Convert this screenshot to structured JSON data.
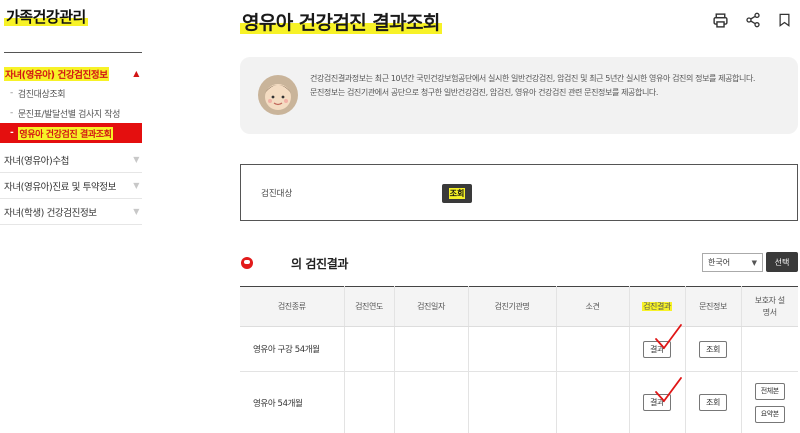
{
  "sidebar": {
    "title": "가족건강관리",
    "menu": [
      {
        "label": "자녀(영유아) 건강검진정보",
        "open": true,
        "children": [
          {
            "label": "검진대상조회",
            "active": false
          },
          {
            "label": "문진표/발달선별 검사지 작성",
            "active": false
          },
          {
            "label": "영유아 건강검진 결과조회",
            "active": true
          }
        ]
      },
      {
        "label": "자녀(영유아)수첩",
        "open": false
      },
      {
        "label": "자녀(영유아)진료 및 투약정보",
        "open": false
      },
      {
        "label": "자녀(학생) 건강검진정보",
        "open": false
      }
    ]
  },
  "header": {
    "title": "영유아 건강검진 결과조회",
    "tools": [
      "printer-icon",
      "share-icon",
      "bookmark-icon"
    ]
  },
  "info": {
    "line1": "건강검진결과정보는 최근 10년간 국민건강보험공단에서 실시한 일반건강검진, 암검진 및 최근 5년간 실시한 영유아 검진의 정보를 제공합니다.",
    "line2": "문진정보는 검진기관에서 공단으로 청구한 일반건강검진, 암검진, 영유아 건강검진 관련 문진정보를 제공합니다."
  },
  "filter": {
    "label": "검진대상",
    "query_button": "조회"
  },
  "results": {
    "title": "의 검진결과",
    "language": "한국어",
    "select_button": "선택",
    "columns": [
      "검진종류",
      "검진연도",
      "검진일자",
      "검진기관명",
      "소견",
      "검진결과",
      "문진정보",
      "보호자 설명서"
    ],
    "rows": [
      {
        "type": "영유아 구강 54개월",
        "year": "",
        "date": "",
        "institution": "",
        "opinion": "",
        "result_button": "결과",
        "interview_button": "조회",
        "guardian_buttons": []
      },
      {
        "type": "영유아 54개월",
        "year": "",
        "date": "",
        "institution": "",
        "opinion": "",
        "result_button": "결과",
        "interview_button": "조회",
        "guardian_buttons": [
          "전체본",
          "요약본"
        ]
      }
    ]
  },
  "colors": {
    "accent_red": "#e40f0f",
    "highlight_yellow": "#f7f227",
    "dark_button": "#3a3a3a"
  }
}
